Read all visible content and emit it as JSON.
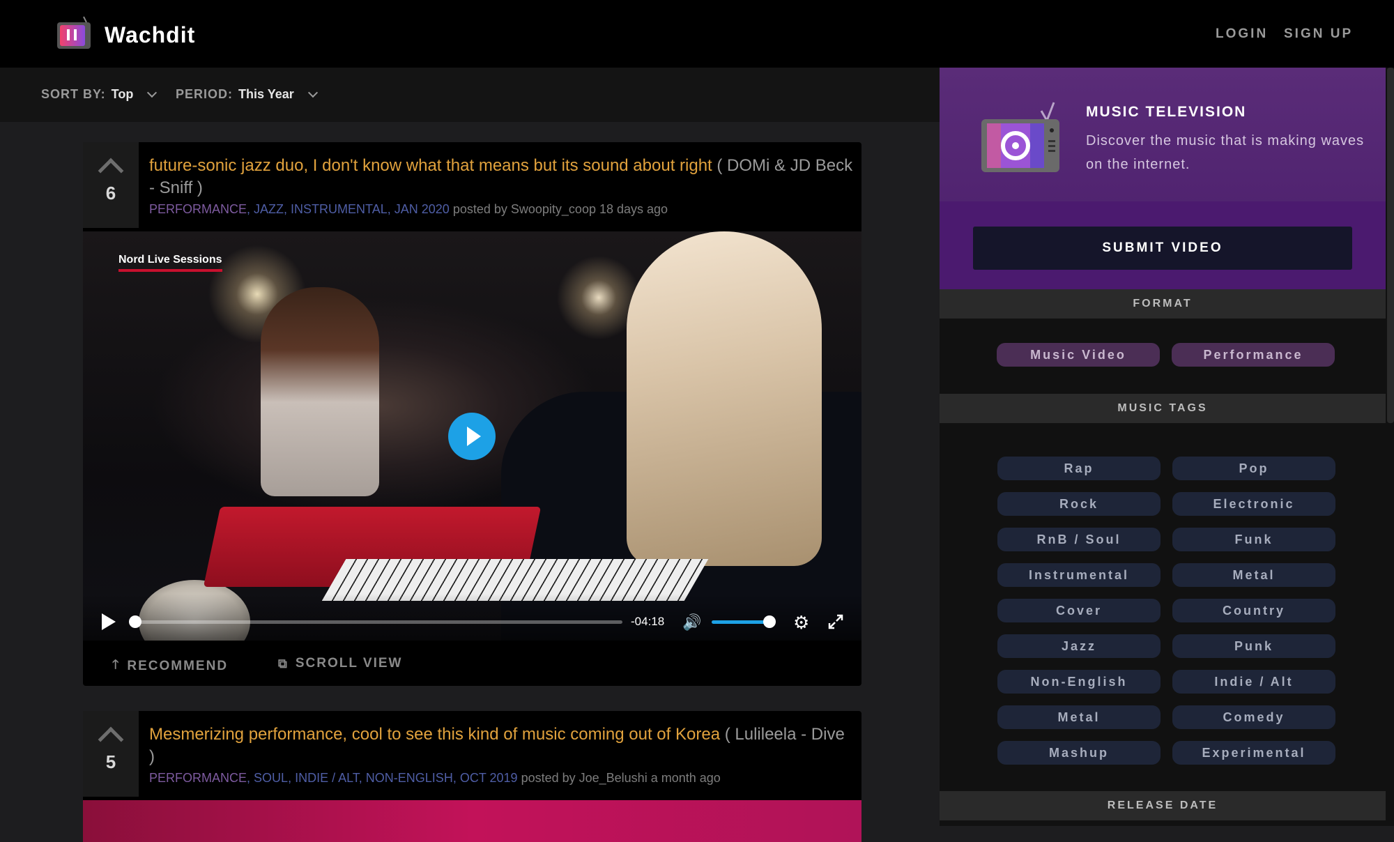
{
  "header": {
    "brand": "Wachdit",
    "login": "LOGIN",
    "signup": "SIGN UP"
  },
  "sortbar": {
    "sort_label": "SORT BY:",
    "sort_value": "Top",
    "period_label": "PERIOD:",
    "period_value": "This Year"
  },
  "posts": [
    {
      "votes": "6",
      "title": "future-sonic jazz duo, I don't know what that means but its sound about right",
      "artist": "( DOMi & JD Beck - Sniff )",
      "tags": [
        "PERFORMANCE",
        "JAZZ",
        "INSTRUMENTAL",
        "JAN 2020"
      ],
      "tag_sep": ", ",
      "posted_by": "posted by Swoopity_coop 18 days ago",
      "video_label": "Nord Live Sessions",
      "time_remaining": "-04:18",
      "progress": 0.0,
      "volume": 0.9,
      "recommend": "RECOMMEND",
      "scroll_view": "SCROLL VIEW"
    },
    {
      "votes": "5",
      "title": "Mesmerizing performance, cool to see this kind of music coming out of Korea",
      "artist": "( Lulileela - Dive )",
      "tags": [
        "PERFORMANCE",
        "SOUL",
        "INDIE / ALT",
        "NON-ENGLISH",
        "OCT 2019"
      ],
      "posted_by": "posted by Joe_Belushi a month ago"
    }
  ],
  "sidebar": {
    "promo_title": "MUSIC TELEVISION",
    "promo_desc": "Discover the music that is making waves on the internet.",
    "submit": "SUBMIT VIDEO",
    "format_head": "FORMAT",
    "formats": [
      "Music Video",
      "Performance"
    ],
    "tags_head": "MUSIC TAGS",
    "tags": [
      "Rap",
      "Pop",
      "Rock",
      "Electronic",
      "RnB / Soul",
      "Funk",
      "Instrumental",
      "Metal",
      "Cover",
      "Country",
      "Jazz",
      "Punk",
      "Non-English",
      "Indie / Alt",
      "Metal",
      "Comedy",
      "Mashup",
      "Experimental"
    ],
    "release_head": "RELEASE DATE"
  },
  "colors": {
    "title": "#e1a23d",
    "tag_performance": "#7e5ba0",
    "tag_genre": "#4f5ea6",
    "accent_blue": "#1da1e6",
    "promo_purple": "#5a2c78"
  }
}
